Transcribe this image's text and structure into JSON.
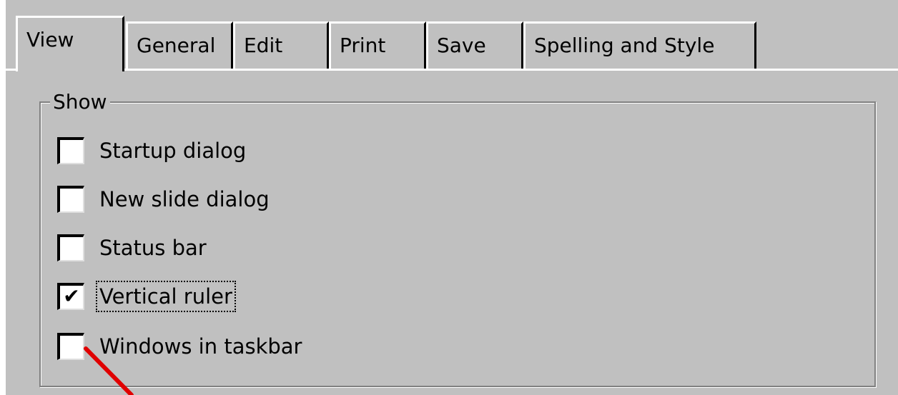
{
  "tabs": [
    {
      "label": "View",
      "active": true
    },
    {
      "label": "General",
      "active": false
    },
    {
      "label": "Edit",
      "active": false
    },
    {
      "label": "Print",
      "active": false
    },
    {
      "label": "Save",
      "active": false
    },
    {
      "label": "Spelling and Style",
      "active": false
    }
  ],
  "group": {
    "title": "Show"
  },
  "options": [
    {
      "label": "Startup dialog",
      "checked": false
    },
    {
      "label": "New slide dialog",
      "checked": false
    },
    {
      "label": "Status bar",
      "checked": false
    },
    {
      "label": "Vertical ruler",
      "checked": true,
      "focused": true
    },
    {
      "label": "Windows in taskbar",
      "checked": false
    }
  ],
  "checkmark": "✔",
  "colors": {
    "dialog_bg": "#c0c0c0",
    "annotation_arrow": "#e00000"
  }
}
